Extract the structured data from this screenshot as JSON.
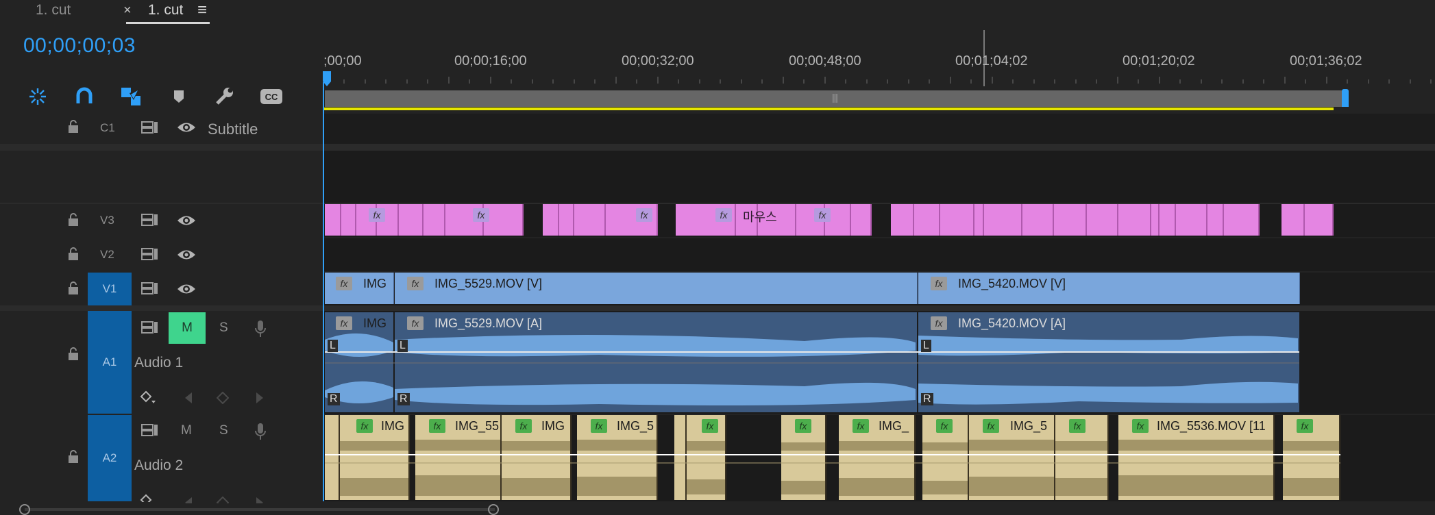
{
  "tabs": [
    {
      "label": "1. cut"
    },
    {
      "label": "1. cut",
      "close": "×",
      "menu": "≡"
    }
  ],
  "timecode": "00;00;00;03",
  "toolbar": {
    "icons": [
      "snap-icon",
      "magnet-icon",
      "linked-selection-icon",
      "marker-icon",
      "wrench-icon",
      "cc-icon"
    ]
  },
  "ruler": {
    "labels": [
      ";00;00",
      "00;00;16;00",
      "00;00;32;00",
      "00;00;48;00",
      "00;01;04;02",
      "00;01;20;02",
      "00;01;36;02"
    ]
  },
  "tracks": {
    "c1": {
      "id": "C1",
      "name": "Subtitle"
    },
    "v3": {
      "id": "V3"
    },
    "v2": {
      "id": "V2"
    },
    "v1": {
      "id": "V1"
    },
    "a1": {
      "id": "A1",
      "name": "Audio 1",
      "mute": "M",
      "solo": "S"
    },
    "a2": {
      "id": "A2",
      "name": "Audio 2",
      "mute": "M",
      "solo": "S"
    }
  },
  "clips": {
    "v3_title": "마우스",
    "v1": [
      "IMG",
      "IMG_5529.MOV [V]",
      "IMG_5420.MOV [V]"
    ],
    "a1": [
      "IMG",
      "IMG_5529.MOV [A]",
      "IMG_5420.MOV [A]"
    ],
    "a2": [
      "IMG",
      "IMG_55",
      "IMG",
      "IMG_5",
      "IMG_",
      "IMG_5",
      "IMG_5536.MOV [11"
    ],
    "channel_l": "L",
    "channel_r": "R",
    "fx": "fx"
  },
  "colors": {
    "accent": "#2f9ff7",
    "track_target": "#0d5fa2",
    "mute_active": "#3fd48d",
    "video_clip": "#7aa6dc",
    "graphics_clip": "#e485e2",
    "audio2_clip": "#d8c99a",
    "work_area": "#e6e600"
  }
}
